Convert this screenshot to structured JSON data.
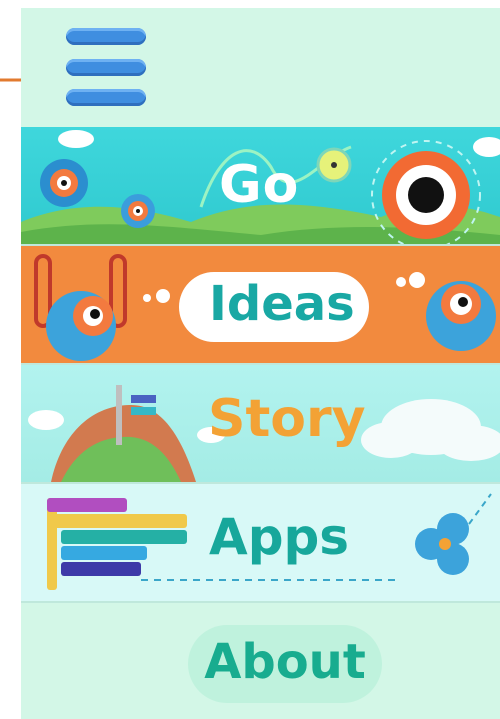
{
  "menu": {
    "icon": "hamburger-menu-icon"
  },
  "pointer": {
    "icon": "arrow-right-icon",
    "color": "#e27a2f"
  },
  "tiles": [
    {
      "label": "Go"
    },
    {
      "label": "Ideas"
    },
    {
      "label": "Story"
    },
    {
      "label": "Apps"
    }
  ],
  "about": {
    "label": "About"
  },
  "colors": {
    "background": "#d3f7e7",
    "go": "#3fd7dc",
    "ideas": "#f28a3e",
    "story": "#a8efe8",
    "apps": "#d8f9f7",
    "menu_blue": "#3f8ee0"
  }
}
